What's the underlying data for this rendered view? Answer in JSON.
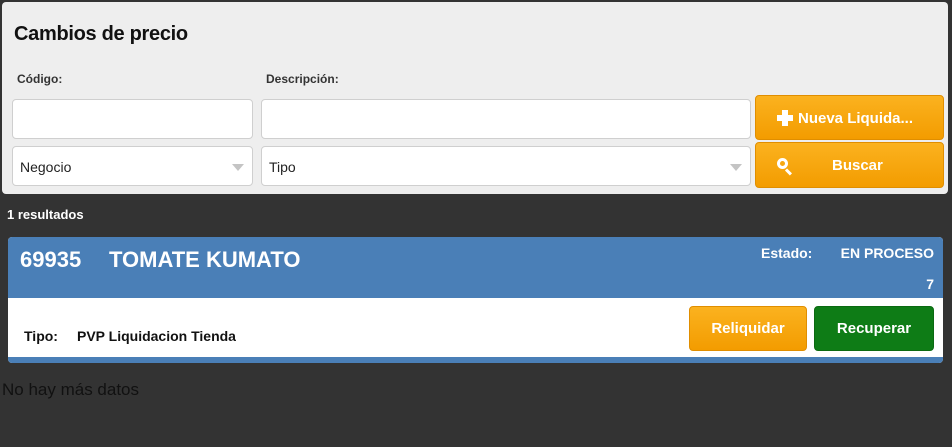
{
  "panel": {
    "title": "Cambios de precio",
    "code_label": "Código:",
    "desc_label": "Descripción:",
    "code_value": "",
    "desc_value": "",
    "negocio_select": "Negocio",
    "tipo_select": "Tipo",
    "new_button": "Nueva Liquida...",
    "search_button": "Buscar"
  },
  "results": {
    "count_text": "1 resultados",
    "items": [
      {
        "code": "69935",
        "name": "TOMATE KUMATO",
        "estado_label": "Estado:",
        "estado_value": "EN PROCESO",
        "number": "7",
        "tipo_label": "Tipo:",
        "tipo_value": "PVP Liquidacion Tienda",
        "reliquidar_label": "Reliquidar",
        "recuperar_label": "Recuperar"
      }
    ],
    "footer_text": "No hay más datos"
  },
  "colors": {
    "background": "#333333",
    "panel": "#eeeeee",
    "accent_orange": "#f5a20f",
    "card_header": "#4a7fb7",
    "success_green": "#0e7c16"
  },
  "icons": [
    "plus-icon",
    "search-icon",
    "chevron-down-icon"
  ]
}
